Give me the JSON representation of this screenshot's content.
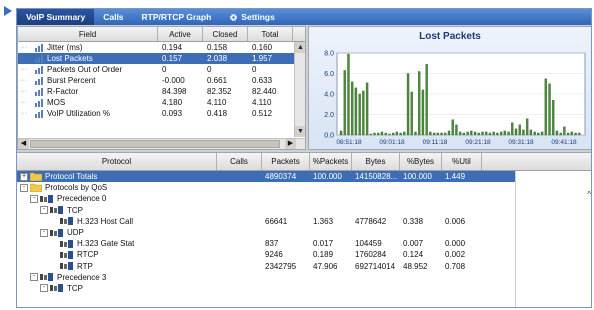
{
  "tabs": [
    {
      "label": "VoIP Summary",
      "active": true
    },
    {
      "label": "Calls",
      "active": false
    },
    {
      "label": "RTP/RTCP Graph",
      "active": false
    },
    {
      "label": "Settings",
      "active": false,
      "icon": "gear-icon"
    }
  ],
  "summary_grid": {
    "columns": [
      "Field",
      "Active",
      "Closed",
      "Total"
    ],
    "rows": [
      {
        "field": "Jitter (ms)",
        "active": "0.194",
        "closed": "0.158",
        "total": "0.160",
        "selected": false
      },
      {
        "field": "Lost Packets",
        "active": "0.157",
        "closed": "2.038",
        "total": "1.957",
        "selected": true
      },
      {
        "field": "Packets Out of Order",
        "active": "0",
        "closed": "0",
        "total": "0",
        "selected": false
      },
      {
        "field": "Burst Percent",
        "active": "-0.000",
        "closed": "0.661",
        "total": "0.633",
        "selected": false
      },
      {
        "field": "R-Factor",
        "active": "84.398",
        "closed": "82.352",
        "total": "82.440",
        "selected": false
      },
      {
        "field": "MOS",
        "active": "4.180",
        "closed": "4.110",
        "total": "4.110",
        "selected": false
      },
      {
        "field": "VoIP Utilization %",
        "active": "0.093",
        "closed": "0.418",
        "total": "0.512",
        "selected": false
      }
    ]
  },
  "chart_data": {
    "type": "bar",
    "title": "Lost Packets",
    "ylim": [
      0,
      8
    ],
    "yticks": [
      "8.0",
      "6.0",
      "4.0",
      "2.0",
      "0.0"
    ],
    "xticks": [
      "08:51:18",
      "09:01:18",
      "09:11:18",
      "09:21:18",
      "09:31:18",
      "09:41:18"
    ],
    "bar_color": "#4a8a3a",
    "values": [
      0.4,
      6.3,
      7.9,
      5.2,
      4.6,
      4.0,
      4.3,
      5.1,
      0.1,
      0.2,
      0.2,
      0.3,
      0.2,
      0.1,
      0.2,
      0.3,
      0.2,
      0.3,
      6.0,
      4.2,
      0.3,
      6.2,
      4.4,
      6.9,
      0.3,
      0.2,
      0.2,
      0.2,
      0.2,
      0.4,
      1.5,
      1.0,
      0.3,
      0.2,
      0.3,
      0.4,
      0.3,
      0.2,
      0.3,
      0.3,
      0.2,
      0.3,
      0.2,
      0.3,
      0.4,
      0.3,
      1.2,
      0.6,
      1.0,
      0.5,
      1.6,
      0.5,
      0.3,
      0.2,
      0.3,
      5.5,
      5.0,
      3.4,
      0.4,
      0.2,
      0.8,
      0.2,
      0.3,
      0.2,
      0.2
    ]
  },
  "protocol_grid": {
    "columns": [
      "Protocol",
      "Calls",
      "Packets",
      "%Packets",
      "Bytes",
      "%Bytes",
      "%Util"
    ],
    "rows": [
      {
        "level": 0,
        "toggle": "+",
        "icon": "folder",
        "name": "Protocol Totals",
        "calls": "",
        "packets": "4890374",
        "pct_packets": "100.000",
        "bytes": "14150828...",
        "pct_bytes": "100.000",
        "util": "1.449",
        "selected": true
      },
      {
        "level": 0,
        "toggle": "-",
        "icon": "folder",
        "name": "Protocols by QoS",
        "calls": "",
        "packets": "",
        "pct_packets": "",
        "bytes": "",
        "pct_bytes": "",
        "util": "",
        "selected": false
      },
      {
        "level": 1,
        "toggle": "-",
        "icon": "net",
        "name": "Precedence 0",
        "calls": "",
        "packets": "",
        "pct_packets": "",
        "bytes": "",
        "pct_bytes": "",
        "util": "",
        "selected": false
      },
      {
        "level": 2,
        "toggle": "-",
        "icon": "net",
        "name": "TCP",
        "calls": "",
        "packets": "",
        "pct_packets": "",
        "bytes": "",
        "pct_bytes": "",
        "util": "",
        "selected": false
      },
      {
        "level": 3,
        "toggle": "",
        "icon": "net",
        "name": "H.323 Host Call",
        "calls": "",
        "packets": "66641",
        "pct_packets": "1.363",
        "bytes": "4778642",
        "pct_bytes": "0.338",
        "util": "0.006",
        "selected": false
      },
      {
        "level": 2,
        "toggle": "-",
        "icon": "net",
        "name": "UDP",
        "calls": "",
        "packets": "",
        "pct_packets": "",
        "bytes": "",
        "pct_bytes": "",
        "util": "",
        "selected": false
      },
      {
        "level": 3,
        "toggle": "",
        "icon": "net",
        "name": "H.323 Gate Stat",
        "calls": "",
        "packets": "837",
        "pct_packets": "0.017",
        "bytes": "104459",
        "pct_bytes": "0.007",
        "util": "0.000",
        "selected": false
      },
      {
        "level": 3,
        "toggle": "",
        "icon": "net",
        "name": "RTCP",
        "calls": "",
        "packets": "9246",
        "pct_packets": "0.189",
        "bytes": "1760284",
        "pct_bytes": "0.124",
        "util": "0.002",
        "selected": false
      },
      {
        "level": 3,
        "toggle": "",
        "icon": "net",
        "name": "RTP",
        "calls": "",
        "packets": "2342795",
        "pct_packets": "47.906",
        "bytes": "692714014",
        "pct_bytes": "48.952",
        "util": "0.708",
        "selected": false
      },
      {
        "level": 1,
        "toggle": "-",
        "icon": "net",
        "name": "Precedence 3",
        "calls": "",
        "packets": "",
        "pct_packets": "",
        "bytes": "",
        "pct_bytes": "",
        "util": "",
        "selected": false
      },
      {
        "level": 2,
        "toggle": "-",
        "icon": "net",
        "name": "TCP",
        "calls": "",
        "packets": "",
        "pct_packets": "",
        "bytes": "",
        "pct_bytes": "",
        "util": "",
        "selected": false
      }
    ]
  }
}
